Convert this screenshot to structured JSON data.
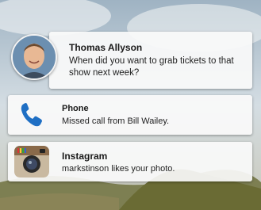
{
  "notifications": [
    {
      "sender": "Thomas Allyson",
      "message": "When did you want to grab tickets to that show next week?",
      "icon": "avatar"
    },
    {
      "app": "Phone",
      "message": "Missed call from Bill Wailey.",
      "icon": "phone-icon"
    },
    {
      "app": "Instagram",
      "message": "markstinson likes your photo.",
      "icon": "instagram-icon"
    }
  ],
  "colors": {
    "sky": "#b9c9d4",
    "hills": "#6f7a3c",
    "card": "#f7f7f7",
    "phone_blue": "#1f6fc4"
  }
}
